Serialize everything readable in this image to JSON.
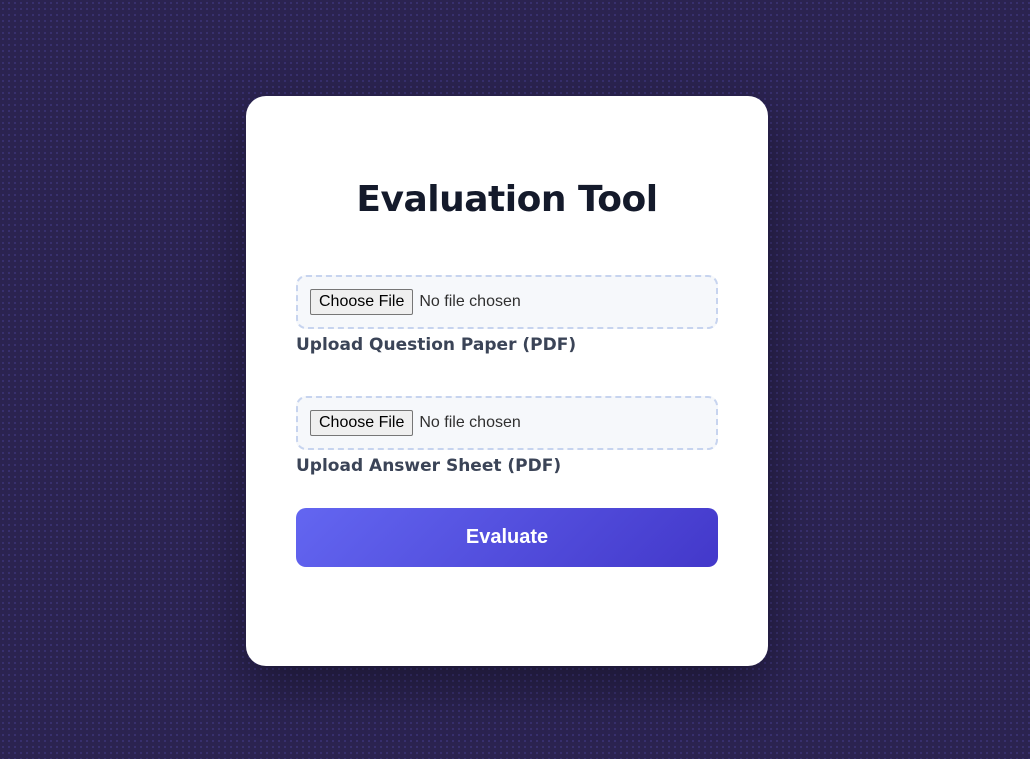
{
  "page": {
    "title": "Evaluation Tool"
  },
  "uploads": [
    {
      "button_label": "Choose File",
      "status_text": "No file chosen",
      "label": "Upload Question Paper (PDF)"
    },
    {
      "button_label": "Choose File",
      "status_text": "No file chosen",
      "label": "Upload Answer Sheet (PDF)"
    }
  ],
  "actions": {
    "evaluate_label": "Evaluate"
  },
  "colors": {
    "background": "#2b2350",
    "card": "#ffffff",
    "title": "#141a2b",
    "label": "#3b4457",
    "button_gradient_start": "#6366f1",
    "button_gradient_end": "#4338ca",
    "dropzone_border": "#c7d4ef",
    "dropzone_fill": "#f6f8fb"
  }
}
